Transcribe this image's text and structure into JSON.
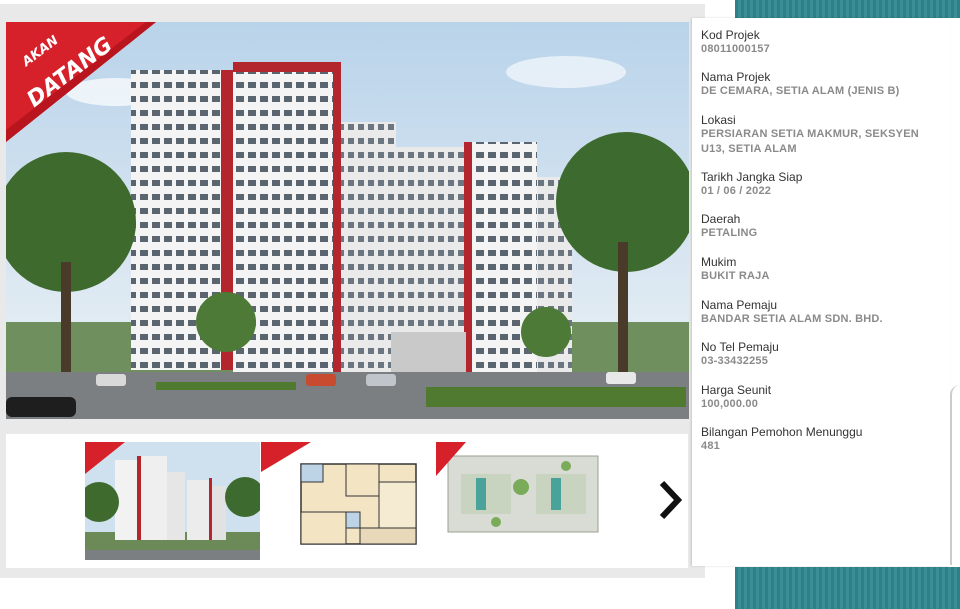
{
  "badge_text": [
    "AKAN",
    "DATANG"
  ],
  "info": [
    {
      "label": "Kod Projek",
      "value": "08011000157"
    },
    {
      "label": "Nama Projek",
      "value": "DE CEMARA, SETIA ALAM (JENIS B)"
    },
    {
      "label": "Lokasi",
      "value": "PERSIARAN SETIA MAKMUR, SEKSYEN U13, SETIA ALAM"
    },
    {
      "label": "Tarikh Jangka Siap",
      "value": "01 / 06 / 2022"
    },
    {
      "label": "Daerah",
      "value": "PETALING"
    },
    {
      "label": "Mukim",
      "value": "BUKIT RAJA"
    },
    {
      "label": "Nama Pemaju",
      "value": "BANDAR SETIA ALAM SDN. BHD."
    },
    {
      "label": "No Tel Pemaju",
      "value": "03-33432255"
    },
    {
      "label": "Harga Seunit",
      "value": "100,000.00"
    },
    {
      "label": "Bilangan Pemohon Menunggu",
      "value": "481"
    }
  ],
  "colors": {
    "badge_red": "#d6202a",
    "accent_teal": "#2f7f86",
    "label_text": "#333333",
    "value_text": "#8a8a8a"
  },
  "icons": {
    "next": "chevron-right-icon"
  }
}
